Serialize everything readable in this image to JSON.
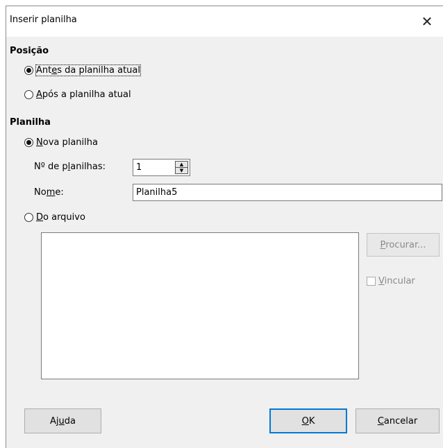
{
  "dialog": {
    "title": "Inserir planilha",
    "close_glyph": "✕"
  },
  "position": {
    "heading": "Posição",
    "before": {
      "pre": "Ant",
      "mnemonic": "e",
      "post": "s da planilha atual",
      "selected": true
    },
    "after": {
      "pre": "",
      "mnemonic": "A",
      "post": "pós a planilha atual",
      "selected": false
    }
  },
  "sheet": {
    "heading": "Planilha",
    "new_sheet": {
      "pre": "",
      "mnemonic": "N",
      "post": "ova planilha",
      "selected": true
    },
    "count_label": {
      "pre": "Nº de p",
      "mnemonic": "l",
      "post": "anilhas:"
    },
    "count_value": "1",
    "name_label": {
      "pre": "No",
      "mnemonic": "m",
      "post": "e:"
    },
    "name_value": "Planilha5",
    "from_file": {
      "pre": "",
      "mnemonic": "D",
      "post": "o arquivo",
      "selected": false
    },
    "browse": {
      "pre": "",
      "mnemonic": "P",
      "post": "rocurar..."
    },
    "link": {
      "pre": "",
      "mnemonic": "V",
      "post": "incular",
      "checked": false
    }
  },
  "footer": {
    "help": {
      "pre": "Aj",
      "mnemonic": "u",
      "post": "da"
    },
    "ok": {
      "pre": "",
      "mnemonic": "O",
      "post": "K"
    },
    "cancel": {
      "pre": "",
      "mnemonic": "C",
      "post": "ancelar"
    }
  },
  "colors": {
    "accent": "#0078d7",
    "dialog_bg": "#f0f0f0"
  }
}
